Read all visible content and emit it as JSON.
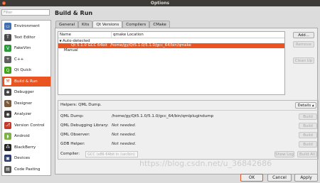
{
  "window": {
    "title": "Options",
    "close_glyph": "×"
  },
  "filter": {
    "placeholder": "Filter"
  },
  "sidebar": {
    "items": [
      {
        "label": "Environment",
        "icon": "monitor-icon",
        "color": "#3f6fb5",
        "glyph": "▭"
      },
      {
        "label": "Text Editor",
        "icon": "text-editor-icon",
        "color": "#4a4a4a",
        "glyph": "T"
      },
      {
        "label": "FakeVim",
        "icon": "fakevim-icon",
        "color": "#2b9a3a",
        "glyph": "V"
      },
      {
        "label": "C++",
        "icon": "cpp-icon",
        "color": "#5f5f5f",
        "glyph": "+"
      },
      {
        "label": "Qt Quick",
        "icon": "qt-quick-icon",
        "color": "#41a318",
        "glyph": "Q"
      },
      {
        "label": "Build & Run",
        "icon": "build-run-icon",
        "color": "#ffffff",
        "glyph": "⚒",
        "selected": true
      },
      {
        "label": "Debugger",
        "icon": "debugger-icon",
        "color": "#444444",
        "glyph": "✱"
      },
      {
        "label": "Designer",
        "icon": "designer-icon",
        "color": "#7a5a3a",
        "glyph": "✎"
      },
      {
        "label": "Analyzer",
        "icon": "analyzer-icon",
        "color": "#3a3a3a",
        "glyph": "◉"
      },
      {
        "label": "Version Control",
        "icon": "version-control-icon",
        "color": "#c0392b",
        "glyph": "⎇"
      },
      {
        "label": "Android",
        "icon": "android-icon",
        "color": "#7cb342",
        "glyph": "◗"
      },
      {
        "label": "BlackBerry",
        "icon": "blackberry-icon",
        "color": "#222222",
        "glyph": "⁂"
      },
      {
        "label": "Devices",
        "icon": "devices-icon",
        "color": "#2a3a6a",
        "glyph": "▣"
      },
      {
        "label": "Code Pasting",
        "icon": "code-pasting-icon",
        "color": "#555555",
        "glyph": "▤"
      }
    ]
  },
  "page": {
    "title": "Build & Run",
    "tabs": [
      {
        "label": "General"
      },
      {
        "label": "Kits"
      },
      {
        "label": "Qt Versions",
        "active": true
      },
      {
        "label": "Compilers"
      },
      {
        "label": "CMake"
      }
    ]
  },
  "versions": {
    "columns": {
      "name": "Name",
      "location": "qmake Location"
    },
    "auto_group": "Auto-detected",
    "selected_row": {
      "name": "Qt 5.1.0 GCC 64bit",
      "location": "/home/gy/Qt5.1.0/5.1.0/gcc_64/bin/qmake"
    },
    "manual_group": "Manual",
    "expand_glyph": "▼",
    "buttons": {
      "add": "Add...",
      "remove": "Remove",
      "clean_up": "Clean Up"
    }
  },
  "details": {
    "helpers": "Helpers: QML Dump.",
    "toggle": "Details ▴",
    "rows": [
      {
        "label": "QML Dump:",
        "value": "/home/gy/Qt5.1.0/5.1.0/gcc_64/bin/qmlplugindump",
        "italic": false,
        "button": "Build"
      },
      {
        "label": "QML Debugging Library:",
        "value": "Not needed.",
        "italic": true,
        "button": "Build"
      },
      {
        "label": "QML Observer:",
        "value": "Not needed.",
        "italic": true,
        "button": "Build"
      },
      {
        "label": "GDB Helper:",
        "value": "Not needed.",
        "italic": true,
        "button": "Build"
      }
    ],
    "compiler_label": "Compiler:",
    "compiler_value": "GCC (x86 64bit in /usr/bin)",
    "show_log": "Show Log",
    "build_all": "Build All"
  },
  "footer": {
    "ok": "OK",
    "cancel": "Cancel",
    "apply": "Apply"
  },
  "watermark": "https://blog.csdn.net/u_36842686"
}
